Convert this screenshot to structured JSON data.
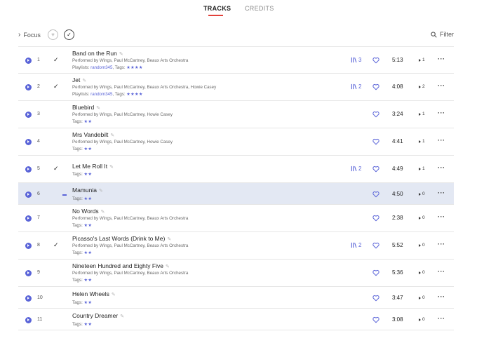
{
  "tabs": {
    "tracks": "TRACKS",
    "credits": "CREDITS"
  },
  "toolbar": {
    "focus": "Focus",
    "filter": "Filter"
  },
  "colors": {
    "accent": "#5a64d8",
    "tab_underline": "#e2413a",
    "highlight_row": "#e3e8f3"
  },
  "labels": {
    "performed_by": "Performed by ",
    "playlists": "Playlists: ",
    "tags": "Tags: "
  },
  "tracks": [
    {
      "num": "1",
      "checked": true,
      "title": "Band on the Run",
      "performers": "Wings, Paul McCartney, Beaux Arts Orchestra",
      "playlists": "random345",
      "tags": "★★★★",
      "versions": "3",
      "duration": "5:13",
      "plays": "1"
    },
    {
      "num": "2",
      "checked": true,
      "title": "Jet",
      "performers": "Wings, Paul McCartney, Beaux Arts Orchestra, Howie Casey",
      "playlists": "random345",
      "tags": "★★★★",
      "versions": "2",
      "duration": "4:08",
      "plays": "2"
    },
    {
      "num": "3",
      "checked": false,
      "title": "Bluebird",
      "performers": "Wings, Paul McCartney, Howie Casey",
      "tags": "★★",
      "duration": "3:24",
      "plays": "1"
    },
    {
      "num": "4",
      "checked": false,
      "title": "Mrs Vandebilt",
      "performers": "Wings, Paul McCartney, Howie Casey",
      "tags": "★★",
      "duration": "4:41",
      "plays": "1"
    },
    {
      "num": "5",
      "checked": true,
      "title": "Let Me Roll It",
      "tags": "★★",
      "versions": "2",
      "duration": "4:49",
      "plays": "1"
    },
    {
      "num": "6",
      "checked": false,
      "dash": true,
      "highlight": true,
      "title": "Mamunia",
      "tags": "★★",
      "duration": "4:50",
      "plays": "0"
    },
    {
      "num": "7",
      "checked": false,
      "title": "No Words",
      "performers": "Wings, Paul McCartney, Beaux Arts Orchestra",
      "tags": "★★",
      "duration": "2:38",
      "plays": "0"
    },
    {
      "num": "8",
      "checked": true,
      "title": "Picasso's Last Words (Drink to Me)",
      "performers": "Wings, Paul McCartney, Beaux Arts Orchestra",
      "tags": "★★",
      "versions": "2",
      "duration": "5:52",
      "plays": "0"
    },
    {
      "num": "9",
      "checked": false,
      "title": "Nineteen Hundred and Eighty Five",
      "performers": "Wings, Paul McCartney, Beaux Arts Orchestra",
      "tags": "★★",
      "duration": "5:36",
      "plays": "0"
    },
    {
      "num": "10",
      "checked": false,
      "title": "Helen Wheels",
      "tags": "★★",
      "duration": "3:47",
      "plays": "0"
    },
    {
      "num": "11",
      "checked": false,
      "title": "Country Dreamer",
      "tags": "★★",
      "duration": "3:08",
      "plays": "0"
    }
  ]
}
